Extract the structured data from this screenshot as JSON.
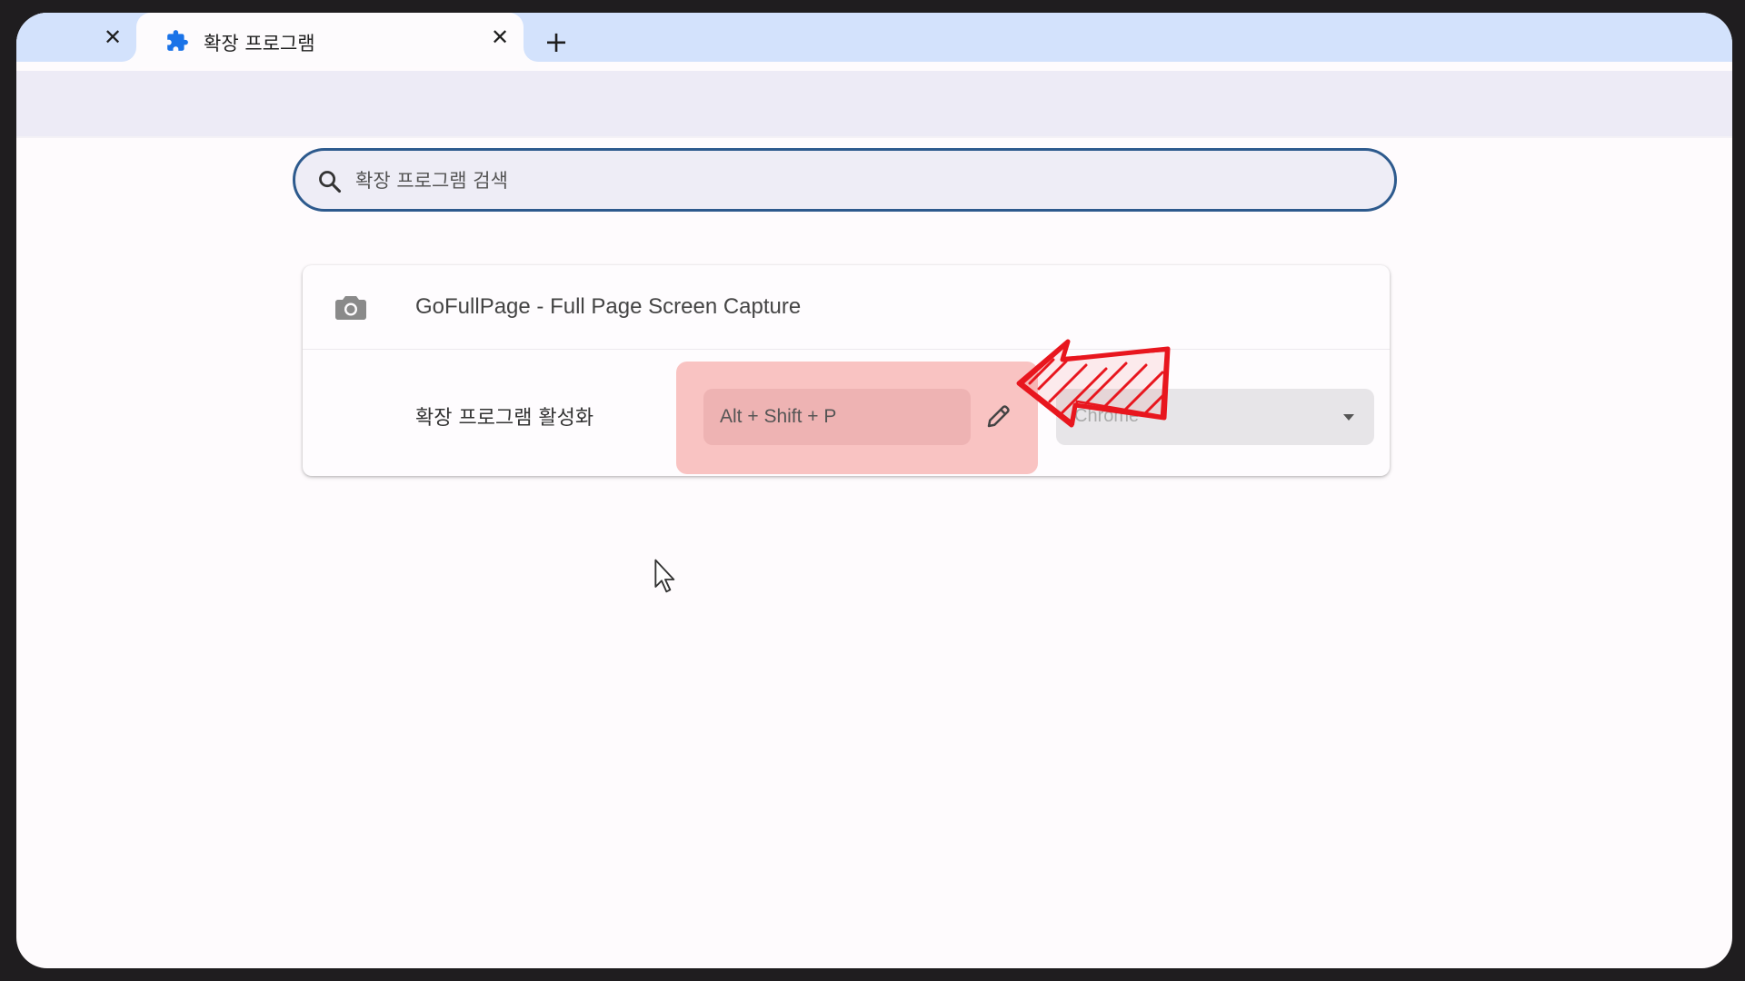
{
  "tabs": {
    "previous_close_label": "✕",
    "active": {
      "title": "확장 프로그램",
      "close_label": "✕",
      "favicon": "puzzle-icon"
    },
    "new_tab_label": "+"
  },
  "search": {
    "placeholder": "확장 프로그램 검색",
    "icon": "search-icon"
  },
  "extension": {
    "name": "GoFullPage - Full Page Screen Capture",
    "icon": "camera-icon",
    "shortcut_row": {
      "label": "확장 프로그램 활성화",
      "shortcut": "Alt + Shift + P",
      "edit_icon": "pencil-icon",
      "scope": "Chrome"
    }
  },
  "colors": {
    "tabstrip": "#d3e2fc",
    "accent": "#1a73e8",
    "highlight": "#f9c3c2",
    "annotation": "#e8161e"
  }
}
